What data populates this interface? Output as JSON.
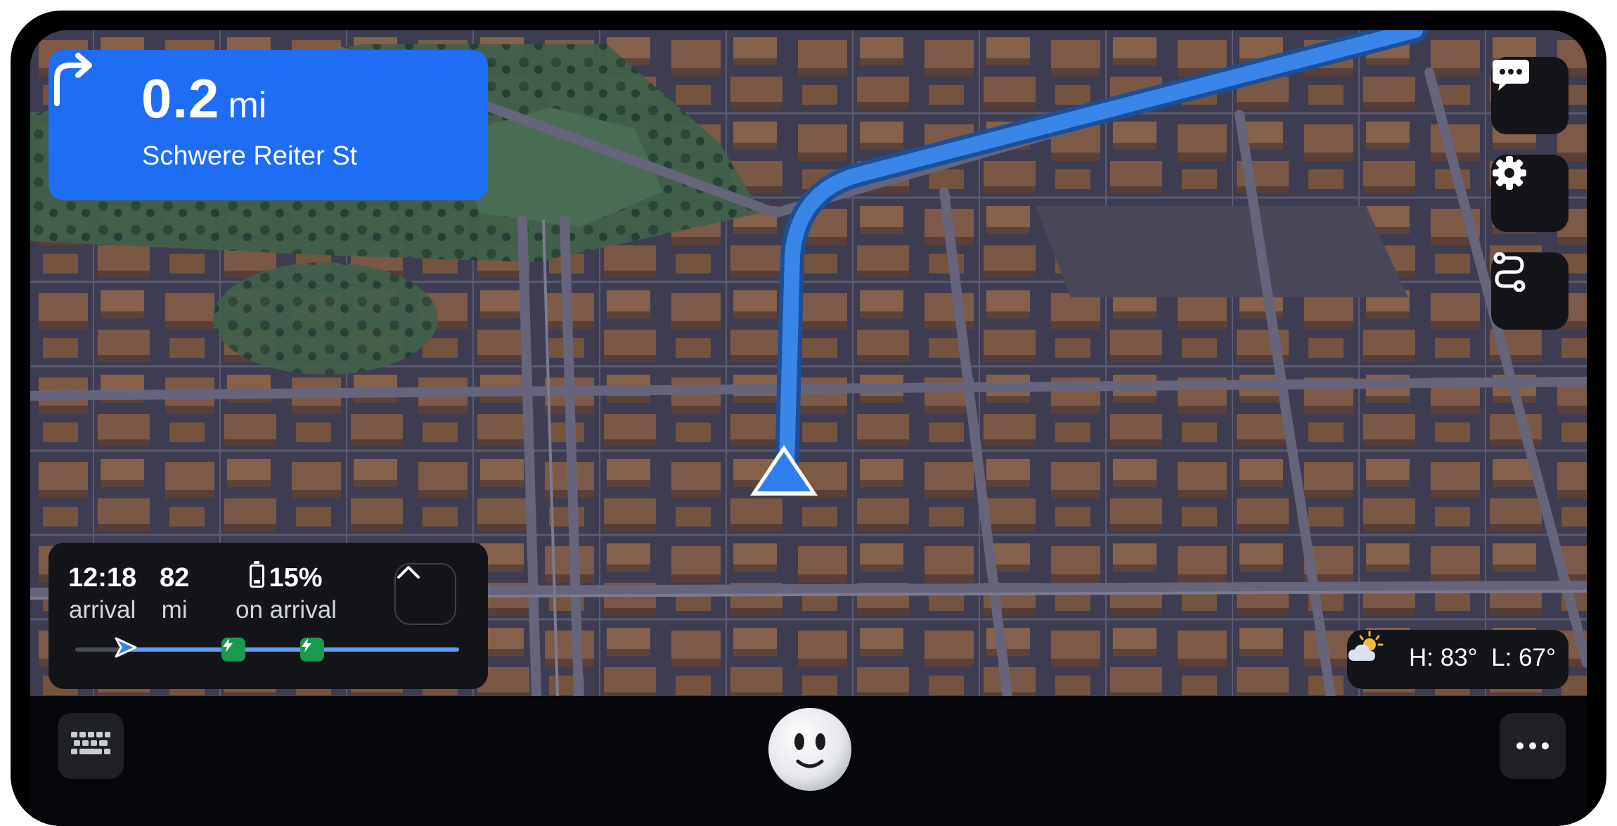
{
  "navigation": {
    "distance_value": "0.2",
    "distance_unit": "mi",
    "street_name": "Schwere Reiter St",
    "maneuver_icon": "turn-right-icon"
  },
  "trip": {
    "arrival_time": "12:18",
    "arrival_label": "arrival",
    "remaining_distance": "82",
    "remaining_distance_label": "mi",
    "battery_on_arrival": "15%",
    "battery_label": "on arrival",
    "progress_fraction": 0.13,
    "charging_stops_count": 2
  },
  "weather": {
    "icon": "partly-cloudy-icon",
    "high": "H: 83°",
    "low": "L: 67°"
  },
  "side_controls": [
    "chat-icon",
    "settings-gear-icon",
    "route-icon"
  ],
  "bottom_bar": {
    "left_button_icon": "keyboard-icon",
    "center_button": "assistant-face",
    "right_button_icon": "more-icon"
  },
  "colors": {
    "accent_blue": "#1f6cf5",
    "route_blue": "#3a86e8",
    "charger_green": "#1a9a4c",
    "panel_dark": "#141519"
  }
}
